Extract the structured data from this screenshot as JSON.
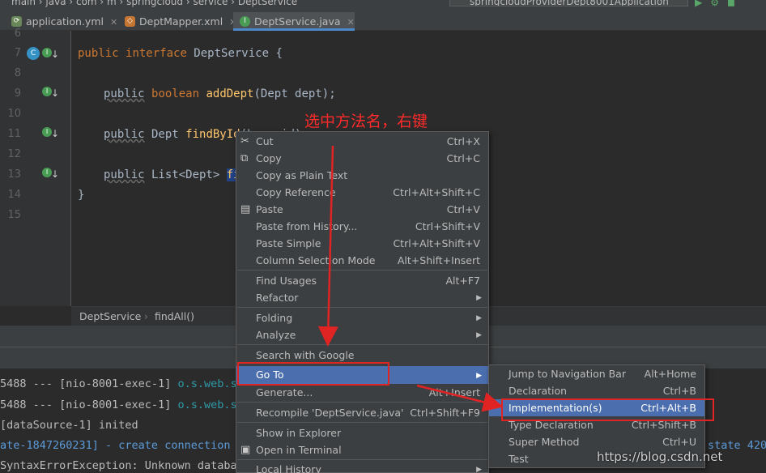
{
  "topbar": {
    "crumbs": "main  ›  java  ›  com  ›  m  ›  springcloud  ›  service  ›  DeptService",
    "run_config": "springcloudProviderDept8001Application"
  },
  "tabs": [
    {
      "label": "application.yml",
      "icon": "yaml-file-icon",
      "active": false
    },
    {
      "label": "DeptMapper.xml",
      "icon": "xml-file-icon",
      "active": false
    },
    {
      "label": "DeptService.java",
      "icon": "interface-icon",
      "active": true
    }
  ],
  "editor": {
    "line_numbers": [
      "6",
      "7",
      "8",
      "9",
      "10",
      "11",
      "12",
      "13",
      "14",
      "15"
    ],
    "lines": {
      "l7": {
        "kw1": "public",
        "kw2": "interface",
        "rest": " DeptService {"
      },
      "l9": {
        "mod": "public",
        "type": "boolean",
        "fn": "addDept",
        "rest": "(Dept dept);"
      },
      "l11": {
        "mod": "public",
        "rest": " Dept ",
        "fn": "findById",
        "tail": "(Long id);"
      },
      "l13": {
        "mod": "public",
        "rest": " List<Dept> ",
        "sel": "findAll"
      },
      "l14": "}"
    }
  },
  "annotation": "选中方法名，右键",
  "navbar": {
    "item1": "DeptService",
    "sep": "›",
    "item2": "findAll()"
  },
  "console": [
    {
      "a": "5488 --- [nio-8001-exec-1] ",
      "pkg": "o.s.web.se"
    },
    {
      "a": "5488 --- [nio-8001-exec-1] ",
      "pkg": "o.s.web.se"
    },
    {
      "a": "[dataSource-1] inited",
      "pkg": ""
    },
    {
      "a": "ate-1847260231] - create connection e",
      "pkg": ""
    },
    {
      "a": "SyntaxErrorException: Unknown databas",
      "pkg": ""
    }
  ],
  "console_right": "state 420",
  "context_menu": [
    {
      "label": "Cut",
      "shortcut": "Ctrl+X",
      "icon": "scissors-icon"
    },
    {
      "label": "Copy",
      "shortcut": "Ctrl+C",
      "icon": "copy-icon"
    },
    {
      "label": "Copy as Plain Text",
      "shortcut": ""
    },
    {
      "label": "Copy Reference",
      "shortcut": "Ctrl+Alt+Shift+C"
    },
    {
      "label": "Paste",
      "shortcut": "Ctrl+V",
      "icon": "clipboard-icon"
    },
    {
      "label": "Paste from History...",
      "shortcut": "Ctrl+Shift+V"
    },
    {
      "label": "Paste Simple",
      "shortcut": "Ctrl+Alt+Shift+V"
    },
    {
      "label": "Column Selection Mode",
      "shortcut": "Alt+Shift+Insert"
    },
    {
      "label": "Find Usages",
      "shortcut": "Alt+F7"
    },
    {
      "label": "Refactor",
      "shortcut": ""
    },
    {
      "label": "Folding",
      "shortcut": ""
    },
    {
      "label": "Analyze",
      "shortcut": ""
    },
    {
      "label": "Search with Google",
      "shortcut": ""
    },
    {
      "label": "Go To",
      "shortcut": ""
    },
    {
      "label": "Generate...",
      "shortcut": "Alt+Insert"
    },
    {
      "label": "Recompile 'DeptService.java'",
      "shortcut": "Ctrl+Shift+F9"
    },
    {
      "label": "Show in Explorer",
      "shortcut": ""
    },
    {
      "label": "Open in Terminal",
      "shortcut": "",
      "icon": "terminal-icon"
    },
    {
      "label": "Local History",
      "shortcut": ""
    }
  ],
  "goto_submenu": [
    {
      "label": "Jump to Navigation Bar",
      "shortcut": "Alt+Home"
    },
    {
      "label": "Declaration",
      "shortcut": "Ctrl+B"
    },
    {
      "label": "Implementation(s)",
      "shortcut": "Ctrl+Alt+B"
    },
    {
      "label": "Type Declaration",
      "shortcut": "Ctrl+Shift+B"
    },
    {
      "label": "Super Method",
      "shortcut": "Ctrl+U"
    },
    {
      "label": "Test",
      "shortcut": ""
    }
  ],
  "watermark": "https://blog.csdn.net",
  "colors": {
    "highlight": "#4b6eaf",
    "annotation_red": "#e02323",
    "keyword": "#cc7832",
    "method": "#ffc66d"
  }
}
